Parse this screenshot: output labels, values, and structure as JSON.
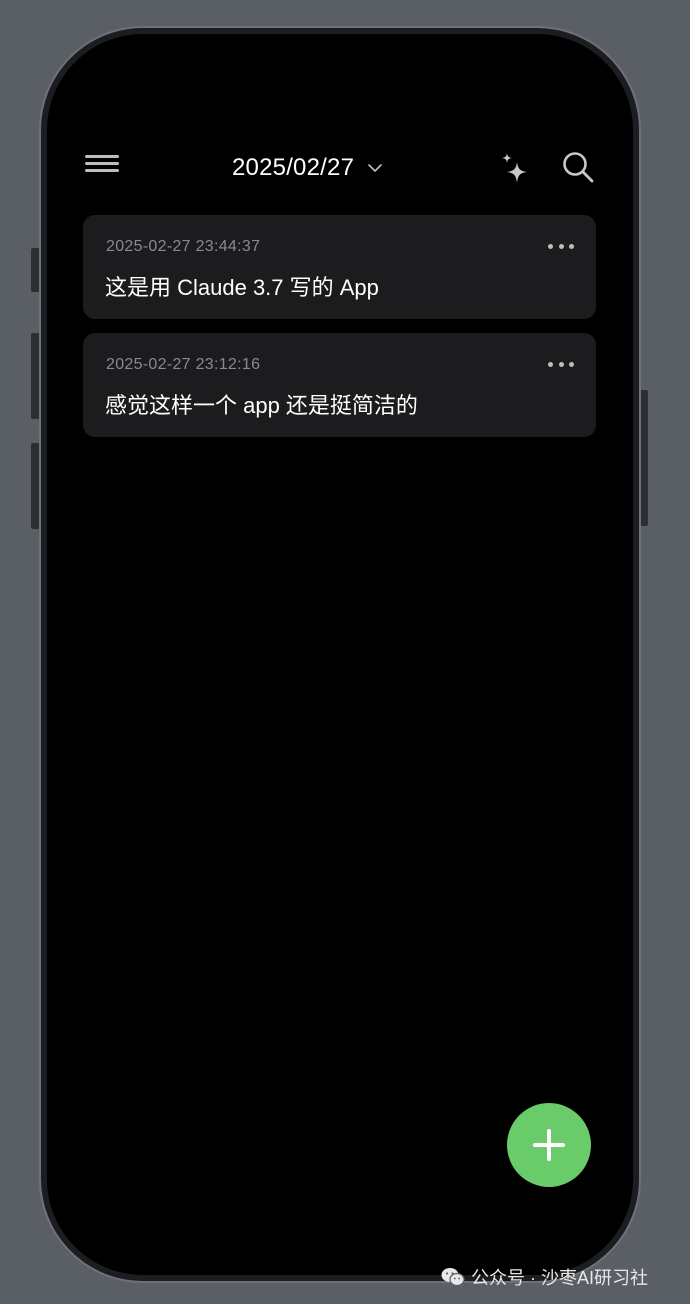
{
  "header": {
    "date": "2025/02/27",
    "icons": {
      "menu": "hamburger-menu-icon",
      "date_dropdown": "chevron-down-icon",
      "ai": "sparkle-icon",
      "search": "search-icon"
    }
  },
  "notes": [
    {
      "timestamp": "2025-02-27 23:44:37",
      "text": "这是用 Claude 3.7 写的 App"
    },
    {
      "timestamp": "2025-02-27 23:12:16",
      "text": "感觉这样一个 app 还是挺简洁的"
    }
  ],
  "fab": {
    "icon": "plus-icon",
    "color": "#6acb6a"
  },
  "watermark": {
    "text": "公众号 · 沙枣AI研习社",
    "icon": "wechat-icon"
  },
  "colors": {
    "background": "#000000",
    "card": "#1c1c1e",
    "accent": "#6acb6a",
    "timestamp": "#8a8a8e"
  }
}
